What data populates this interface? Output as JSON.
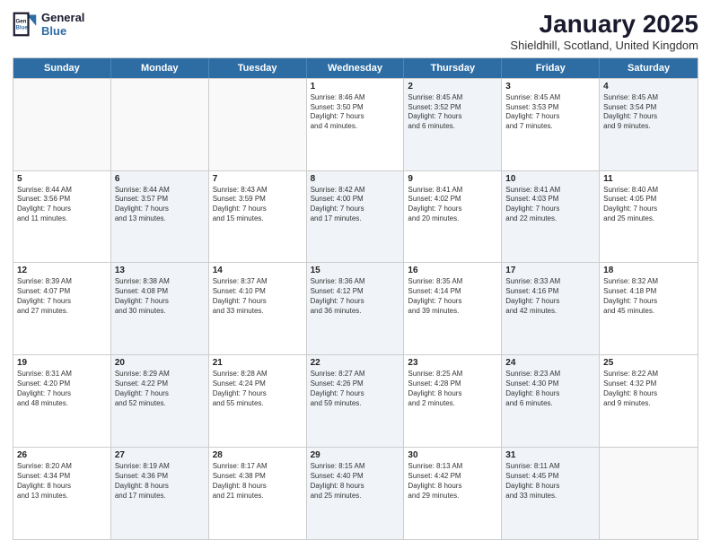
{
  "header": {
    "logo_line1": "General",
    "logo_line2": "Blue",
    "title": "January 2025",
    "subtitle": "Shieldhill, Scotland, United Kingdom"
  },
  "weekdays": [
    "Sunday",
    "Monday",
    "Tuesday",
    "Wednesday",
    "Thursday",
    "Friday",
    "Saturday"
  ],
  "rows": [
    [
      {
        "day": "",
        "lines": [],
        "shaded": false,
        "empty": true
      },
      {
        "day": "",
        "lines": [],
        "shaded": false,
        "empty": true
      },
      {
        "day": "",
        "lines": [],
        "shaded": false,
        "empty": true
      },
      {
        "day": "1",
        "lines": [
          "Sunrise: 8:46 AM",
          "Sunset: 3:50 PM",
          "Daylight: 7 hours",
          "and 4 minutes."
        ],
        "shaded": false,
        "empty": false
      },
      {
        "day": "2",
        "lines": [
          "Sunrise: 8:45 AM",
          "Sunset: 3:52 PM",
          "Daylight: 7 hours",
          "and 6 minutes."
        ],
        "shaded": true,
        "empty": false
      },
      {
        "day": "3",
        "lines": [
          "Sunrise: 8:45 AM",
          "Sunset: 3:53 PM",
          "Daylight: 7 hours",
          "and 7 minutes."
        ],
        "shaded": false,
        "empty": false
      },
      {
        "day": "4",
        "lines": [
          "Sunrise: 8:45 AM",
          "Sunset: 3:54 PM",
          "Daylight: 7 hours",
          "and 9 minutes."
        ],
        "shaded": true,
        "empty": false
      }
    ],
    [
      {
        "day": "5",
        "lines": [
          "Sunrise: 8:44 AM",
          "Sunset: 3:56 PM",
          "Daylight: 7 hours",
          "and 11 minutes."
        ],
        "shaded": false,
        "empty": false
      },
      {
        "day": "6",
        "lines": [
          "Sunrise: 8:44 AM",
          "Sunset: 3:57 PM",
          "Daylight: 7 hours",
          "and 13 minutes."
        ],
        "shaded": true,
        "empty": false
      },
      {
        "day": "7",
        "lines": [
          "Sunrise: 8:43 AM",
          "Sunset: 3:59 PM",
          "Daylight: 7 hours",
          "and 15 minutes."
        ],
        "shaded": false,
        "empty": false
      },
      {
        "day": "8",
        "lines": [
          "Sunrise: 8:42 AM",
          "Sunset: 4:00 PM",
          "Daylight: 7 hours",
          "and 17 minutes."
        ],
        "shaded": true,
        "empty": false
      },
      {
        "day": "9",
        "lines": [
          "Sunrise: 8:41 AM",
          "Sunset: 4:02 PM",
          "Daylight: 7 hours",
          "and 20 minutes."
        ],
        "shaded": false,
        "empty": false
      },
      {
        "day": "10",
        "lines": [
          "Sunrise: 8:41 AM",
          "Sunset: 4:03 PM",
          "Daylight: 7 hours",
          "and 22 minutes."
        ],
        "shaded": true,
        "empty": false
      },
      {
        "day": "11",
        "lines": [
          "Sunrise: 8:40 AM",
          "Sunset: 4:05 PM",
          "Daylight: 7 hours",
          "and 25 minutes."
        ],
        "shaded": false,
        "empty": false
      }
    ],
    [
      {
        "day": "12",
        "lines": [
          "Sunrise: 8:39 AM",
          "Sunset: 4:07 PM",
          "Daylight: 7 hours",
          "and 27 minutes."
        ],
        "shaded": false,
        "empty": false
      },
      {
        "day": "13",
        "lines": [
          "Sunrise: 8:38 AM",
          "Sunset: 4:08 PM",
          "Daylight: 7 hours",
          "and 30 minutes."
        ],
        "shaded": true,
        "empty": false
      },
      {
        "day": "14",
        "lines": [
          "Sunrise: 8:37 AM",
          "Sunset: 4:10 PM",
          "Daylight: 7 hours",
          "and 33 minutes."
        ],
        "shaded": false,
        "empty": false
      },
      {
        "day": "15",
        "lines": [
          "Sunrise: 8:36 AM",
          "Sunset: 4:12 PM",
          "Daylight: 7 hours",
          "and 36 minutes."
        ],
        "shaded": true,
        "empty": false
      },
      {
        "day": "16",
        "lines": [
          "Sunrise: 8:35 AM",
          "Sunset: 4:14 PM",
          "Daylight: 7 hours",
          "and 39 minutes."
        ],
        "shaded": false,
        "empty": false
      },
      {
        "day": "17",
        "lines": [
          "Sunrise: 8:33 AM",
          "Sunset: 4:16 PM",
          "Daylight: 7 hours",
          "and 42 minutes."
        ],
        "shaded": true,
        "empty": false
      },
      {
        "day": "18",
        "lines": [
          "Sunrise: 8:32 AM",
          "Sunset: 4:18 PM",
          "Daylight: 7 hours",
          "and 45 minutes."
        ],
        "shaded": false,
        "empty": false
      }
    ],
    [
      {
        "day": "19",
        "lines": [
          "Sunrise: 8:31 AM",
          "Sunset: 4:20 PM",
          "Daylight: 7 hours",
          "and 48 minutes."
        ],
        "shaded": false,
        "empty": false
      },
      {
        "day": "20",
        "lines": [
          "Sunrise: 8:29 AM",
          "Sunset: 4:22 PM",
          "Daylight: 7 hours",
          "and 52 minutes."
        ],
        "shaded": true,
        "empty": false
      },
      {
        "day": "21",
        "lines": [
          "Sunrise: 8:28 AM",
          "Sunset: 4:24 PM",
          "Daylight: 7 hours",
          "and 55 minutes."
        ],
        "shaded": false,
        "empty": false
      },
      {
        "day": "22",
        "lines": [
          "Sunrise: 8:27 AM",
          "Sunset: 4:26 PM",
          "Daylight: 7 hours",
          "and 59 minutes."
        ],
        "shaded": true,
        "empty": false
      },
      {
        "day": "23",
        "lines": [
          "Sunrise: 8:25 AM",
          "Sunset: 4:28 PM",
          "Daylight: 8 hours",
          "and 2 minutes."
        ],
        "shaded": false,
        "empty": false
      },
      {
        "day": "24",
        "lines": [
          "Sunrise: 8:23 AM",
          "Sunset: 4:30 PM",
          "Daylight: 8 hours",
          "and 6 minutes."
        ],
        "shaded": true,
        "empty": false
      },
      {
        "day": "25",
        "lines": [
          "Sunrise: 8:22 AM",
          "Sunset: 4:32 PM",
          "Daylight: 8 hours",
          "and 9 minutes."
        ],
        "shaded": false,
        "empty": false
      }
    ],
    [
      {
        "day": "26",
        "lines": [
          "Sunrise: 8:20 AM",
          "Sunset: 4:34 PM",
          "Daylight: 8 hours",
          "and 13 minutes."
        ],
        "shaded": false,
        "empty": false
      },
      {
        "day": "27",
        "lines": [
          "Sunrise: 8:19 AM",
          "Sunset: 4:36 PM",
          "Daylight: 8 hours",
          "and 17 minutes."
        ],
        "shaded": true,
        "empty": false
      },
      {
        "day": "28",
        "lines": [
          "Sunrise: 8:17 AM",
          "Sunset: 4:38 PM",
          "Daylight: 8 hours",
          "and 21 minutes."
        ],
        "shaded": false,
        "empty": false
      },
      {
        "day": "29",
        "lines": [
          "Sunrise: 8:15 AM",
          "Sunset: 4:40 PM",
          "Daylight: 8 hours",
          "and 25 minutes."
        ],
        "shaded": true,
        "empty": false
      },
      {
        "day": "30",
        "lines": [
          "Sunrise: 8:13 AM",
          "Sunset: 4:42 PM",
          "Daylight: 8 hours",
          "and 29 minutes."
        ],
        "shaded": false,
        "empty": false
      },
      {
        "day": "31",
        "lines": [
          "Sunrise: 8:11 AM",
          "Sunset: 4:45 PM",
          "Daylight: 8 hours",
          "and 33 minutes."
        ],
        "shaded": true,
        "empty": false
      },
      {
        "day": "",
        "lines": [],
        "shaded": false,
        "empty": true
      }
    ]
  ]
}
